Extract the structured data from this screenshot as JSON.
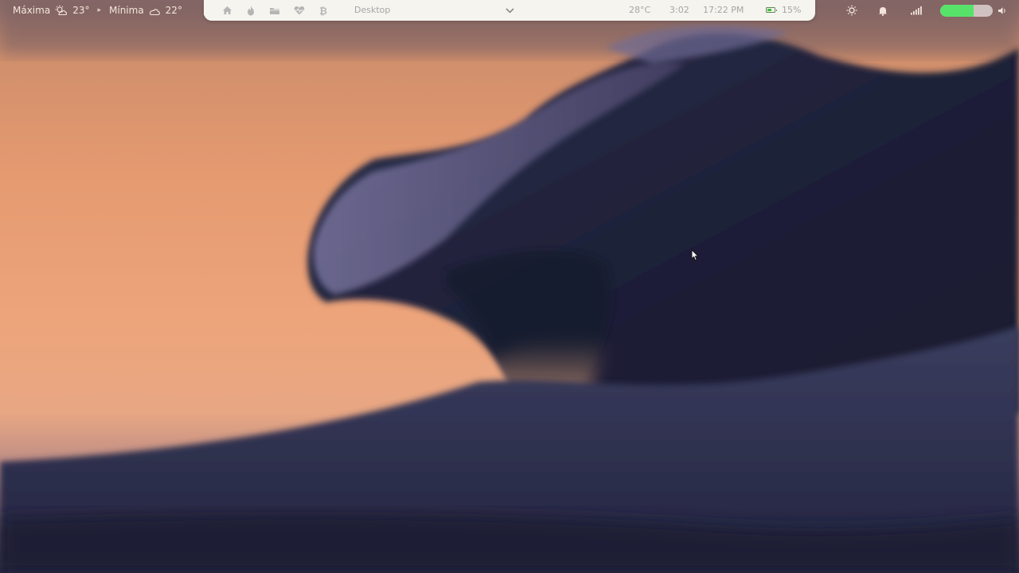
{
  "weather": {
    "max_label": "Máxima",
    "max_temp": "23°",
    "min_label": "Mínima",
    "min_temp": "22°",
    "max_icon": "partly-sunny-icon",
    "min_icon": "cloud-icon"
  },
  "panel": {
    "launchers": [
      {
        "name": "home-icon"
      },
      {
        "name": "flame-icon"
      },
      {
        "name": "folder-icon"
      },
      {
        "name": "heart-pulse-icon"
      },
      {
        "name": "bitcoin-icon"
      }
    ],
    "workspace_label": "Desktop",
    "temperature": "28°C",
    "timer": "3:02",
    "clock": "17:22 PM",
    "battery_percent": "15%",
    "battery_level": 0.15
  },
  "tray": {
    "icons": [
      "brightness-icon",
      "bell-icon",
      "signal-icon",
      "volume-icon"
    ],
    "volume_level": 0.63
  },
  "colors": {
    "panel_bg": "#f6f4ef",
    "panel_text": "#a5a5a5",
    "accent_green": "#57e36a",
    "battery_green": "#3fbf3f"
  }
}
